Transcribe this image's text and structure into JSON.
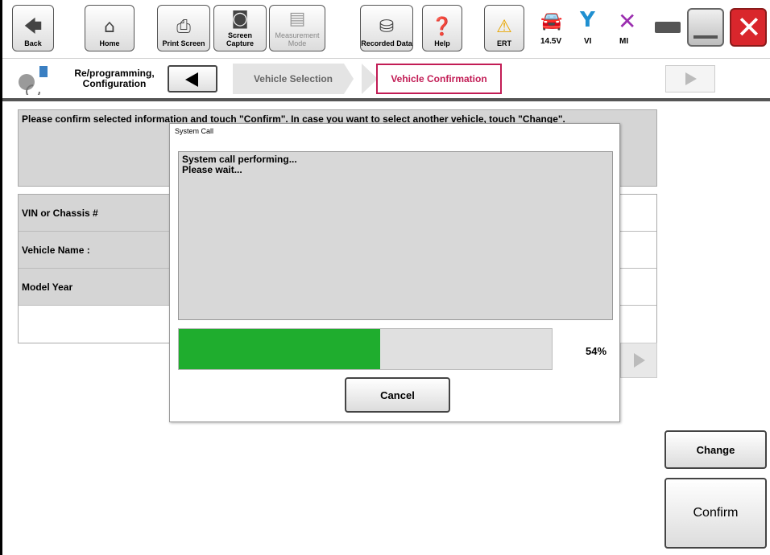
{
  "toolbar": {
    "buttons": [
      {
        "label": "Back",
        "icon": "back-arrow-icon"
      },
      {
        "label": "Home",
        "icon": "home-icon"
      },
      {
        "label": "Print Screen",
        "icon": "printer-icon"
      },
      {
        "label": "Screen Capture",
        "icon": "camera-icon"
      },
      {
        "label": "Measurement Mode",
        "icon": "measurement-icon"
      },
      {
        "label": "Recorded Data",
        "icon": "recorded-data-icon"
      },
      {
        "label": "Help",
        "icon": "help-icon"
      },
      {
        "label": "ERT",
        "icon": "warning-icon"
      }
    ],
    "battery_voltage": "14.5V",
    "vi_label": "VI",
    "mi_label": "MI"
  },
  "nav": {
    "section_label": "Re/programming, Configuration",
    "crumbs": [
      "Vehicle Selection",
      "Vehicle Confirmation"
    ]
  },
  "main": {
    "message": "Please confirm selected information and touch \"Confirm\". In case you want to select another vehicle, touch \"Change\".",
    "rows": [
      {
        "key": "VIN or Chassis #",
        "value": ""
      },
      {
        "key": "Vehicle Name :",
        "value": ""
      },
      {
        "key": "Model Year",
        "value": ""
      },
      {
        "key": "",
        "value": ""
      }
    ],
    "change_label": "Change",
    "confirm_label": "Confirm"
  },
  "dialog": {
    "title": "System Call",
    "line1": "System call performing...",
    "line2": "Please wait...",
    "progress": 54,
    "progress_text": "54%",
    "cancel_label": "Cancel"
  },
  "colors": {
    "accent": "#c21c55",
    "progress": "#1fad2e",
    "close_red": "#d9262c"
  }
}
